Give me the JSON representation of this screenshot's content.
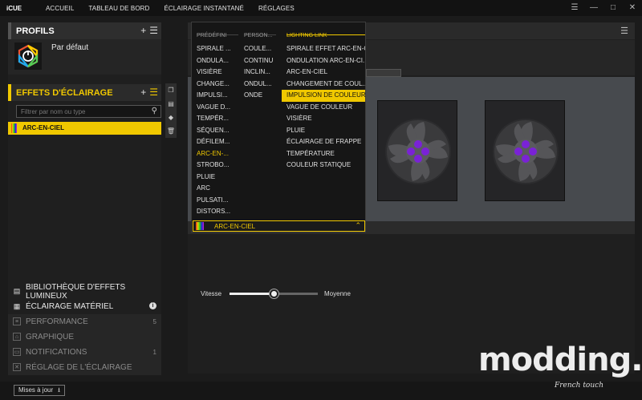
{
  "app": {
    "title": "iCUE",
    "nav": [
      "ACCUEIL",
      "TABLEAU DE BORD",
      "ÉCLAIRAGE INSTANTANÉ",
      "RÉGLAGES"
    ],
    "window_buttons": [
      "☰",
      "—",
      "□",
      "✕"
    ]
  },
  "left": {
    "profiles_label": "PROFILS",
    "profile_name": "Par défaut",
    "effects_label": "EFFETS D'ÉCLAIRAGE",
    "search_placeholder": "Filtrer par nom ou type",
    "effect_item": "ARC-EN-CIEL",
    "bottom_items": [
      {
        "label": "BIBLIOTHÈQUE D'EFFETS LUMINEUX",
        "count": ""
      },
      {
        "label": "ÉCLAIRAGE MATÉRIEL",
        "count": ""
      },
      {
        "label": "PERFORMANCE",
        "count": "5"
      },
      {
        "label": "GRAPHIQUE",
        "count": ""
      },
      {
        "label": "NOTIFICATIONS",
        "count": "1"
      },
      {
        "label": "RÉGLAGE DE L'ÉCLAIRAGE",
        "count": ""
      }
    ]
  },
  "dropdown": {
    "columns": [
      {
        "header": "PRÉDÉFINI",
        "items": [
          "SPIRALE ...",
          "ONDULA...",
          "VISIÈRE",
          "CHANGE...",
          "IMPULSI...",
          "VAGUE D...",
          "TEMPÉR...",
          "SÉQUEN...",
          "DÉFILEM...",
          "ARC-EN-...",
          "STROBO...",
          "PLUIE",
          "ARC",
          "PULSATI...",
          "DISTORS..."
        ]
      },
      {
        "header": "PERSON...",
        "items": [
          "COULE...",
          "CONTINU",
          "INCLIN...",
          "ONDUL...",
          "ONDE"
        ]
      },
      {
        "header": "LIGHTING LINK",
        "items": [
          "SPIRALE EFFET ARC-EN-C...",
          "ONDULATION ARC-EN-CI...",
          "ARC-EN-CIEL",
          "CHANGEMENT DE COUL...",
          "IMPULSION DE COULEUR",
          "VAGUE DE COULEUR",
          "VISIÈRE",
          "PLUIE",
          "ÉCLAIRAGE DE FRAPPE",
          "TEMPÉRATURE",
          "COULEUR STATIQUE"
        ]
      }
    ],
    "selected_label": "ARC-EN-CIEL"
  },
  "speed": {
    "label": "Vitesse",
    "value_label": "Moyenne",
    "level": 0.5
  },
  "status": {
    "update_label": "Mises à jour"
  },
  "watermark": {
    "text": "modding.fr",
    "sub": "French touch"
  },
  "colors": {
    "accent": "#f0c800",
    "led": "#7a22d6"
  }
}
